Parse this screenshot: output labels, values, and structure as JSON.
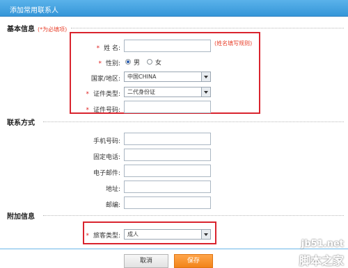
{
  "window": {
    "title": "添加常用联系人"
  },
  "sections": {
    "basic": {
      "title": "基本信息",
      "required_note": "(*为必填项)"
    },
    "contact": {
      "title": "联系方式"
    },
    "extra": {
      "title": "附加信息"
    }
  },
  "basic_form": {
    "name": {
      "star": "*",
      "label": "姓 名:",
      "value": "",
      "hint": "(姓名填写规则)"
    },
    "gender": {
      "star": "*",
      "label": "性别:",
      "options": [
        "男",
        "女"
      ],
      "selected": "男"
    },
    "country": {
      "label": "国家/地区:",
      "value": "中国CHINA"
    },
    "id_type": {
      "star": "*",
      "label": "证件类型:",
      "value": "二代身份证"
    },
    "id_number": {
      "star": "*",
      "label": "证件号码:",
      "value": ""
    }
  },
  "contact_form": {
    "mobile": {
      "label": "手机号码:",
      "value": ""
    },
    "phone": {
      "label": "固定电话:",
      "value": ""
    },
    "email": {
      "label": "电子邮件:",
      "value": ""
    },
    "address": {
      "label": "地址:",
      "value": ""
    },
    "postcode": {
      "label": "邮编:",
      "value": ""
    }
  },
  "extra_form": {
    "traveler_type": {
      "star": "*",
      "label": "旅客类型:",
      "value": "成人"
    }
  },
  "buttons": {
    "cancel": "取消",
    "save": "保存"
  },
  "watermark": {
    "site": "jb51.net",
    "name": "脚本之家"
  },
  "colors": {
    "title_bar": "#3596d8",
    "highlight_border": "#d9232d",
    "required": "#e02020",
    "save_button": "#f28419"
  }
}
